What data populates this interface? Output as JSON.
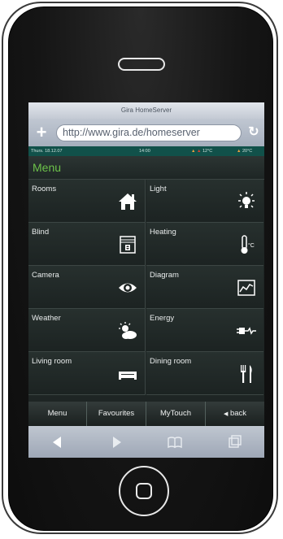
{
  "browser": {
    "title": "Gira HomeServer",
    "url": "http://www.gira.de/homeserver"
  },
  "status": {
    "date": "Thurs. 18.12.07",
    "time": "14:00",
    "temp_outdoor": "12°C",
    "temp_indoor": "20°C"
  },
  "menu": {
    "title": "Menu",
    "tiles": [
      {
        "label": "Rooms",
        "icon": "house-icon"
      },
      {
        "label": "Light",
        "icon": "lightbulb-icon"
      },
      {
        "label": "Blind",
        "icon": "blind-icon"
      },
      {
        "label": "Heating",
        "icon": "thermometer-icon"
      },
      {
        "label": "Camera",
        "icon": "eye-icon"
      },
      {
        "label": "Diagram",
        "icon": "chart-icon"
      },
      {
        "label": "Weather",
        "icon": "weather-icon"
      },
      {
        "label": "Energy",
        "icon": "plug-icon"
      },
      {
        "label": "Living room",
        "icon": "sofa-icon"
      },
      {
        "label": "Dining room",
        "icon": "cutlery-icon"
      }
    ]
  },
  "tabs": {
    "menu": "Menu",
    "favourites": "Favourites",
    "mytouch": "MyTouch",
    "back": "back"
  },
  "toolbar_icons": [
    "back-arrow-icon",
    "forward-arrow-icon",
    "bookmarks-icon",
    "pages-icon"
  ],
  "colors": {
    "accent_green": "#6cc24a",
    "status_bar": "#11514a",
    "tile_bg": "#232b2a"
  }
}
